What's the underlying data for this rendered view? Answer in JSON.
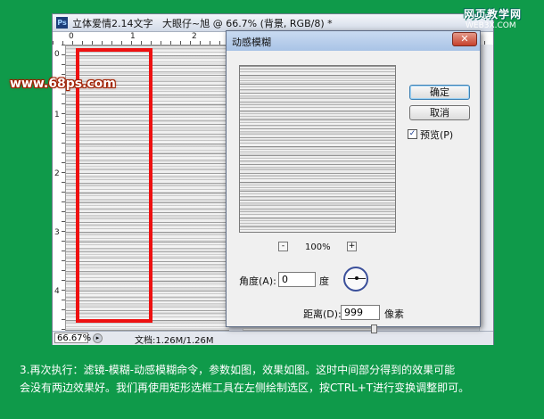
{
  "photoshop_window": {
    "title": "立体爱情2.14文字   大眼仔~旭 @ 66.7% (背景, RGB/8) *",
    "app_icon": "Ps",
    "ruler_top_ticks": [
      "0",
      "1",
      "2"
    ],
    "ruler_left_ticks": [
      "0",
      "1",
      "2",
      "3",
      "4"
    ],
    "status_zoom": "66.67%",
    "status_doc": "文档:1.26M/1.26M"
  },
  "watermark": {
    "site": "www.68ps.com",
    "logo_cn": "网页教学网",
    "logo_url": "WEB3X.COM"
  },
  "dialog": {
    "title": "动感模糊",
    "ok_label": "确定",
    "cancel_label": "取消",
    "preview_label": "预览(P)",
    "preview_checked": "✓",
    "zoom_out": "-",
    "zoom_in": "+",
    "zoom_level": "100%",
    "angle_label": "角度(A):",
    "angle_value": "0",
    "angle_unit": "度",
    "distance_label": "距离(D):",
    "distance_value": "999",
    "distance_unit": "像素",
    "distance_slider_fraction": 0.98
  },
  "caption": {
    "line1": "3.再次执行：滤镜-模糊-动感模糊命令，参数如图，效果如图。这时中间部分得到的效果可能",
    "line2": "会没有两边效果好。我们再使用矩形选框工具在左侧绘制选区，按CTRL+T进行变换调整即可。"
  },
  "colors": {
    "background": "#0f9a4a",
    "selection": "#ee1111"
  }
}
